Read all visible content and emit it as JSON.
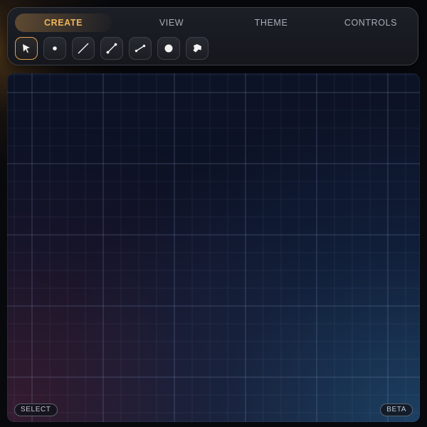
{
  "toolbar": {
    "tabs": [
      {
        "label": "CREATE",
        "active": true
      },
      {
        "label": "VIEW",
        "active": false
      },
      {
        "label": "THEME",
        "active": false
      },
      {
        "label": "CONTROLS",
        "active": false
      }
    ],
    "tools": [
      {
        "icon": "pointer-arrow-icon",
        "active": true
      },
      {
        "icon": "point-icon",
        "active": false
      },
      {
        "icon": "line-icon",
        "active": false
      },
      {
        "icon": "segment-icon",
        "active": false
      },
      {
        "icon": "short-segment-icon",
        "active": false
      },
      {
        "icon": "circle-icon",
        "active": false
      },
      {
        "icon": "polygon-icon",
        "active": false
      }
    ]
  },
  "canvas": {
    "mode_label": "SELECT",
    "badge_label": "BETA"
  },
  "colors": {
    "accent": "#f0b45a",
    "active_border": "#e0a14a",
    "tab_text": "#a9adb5",
    "canvas_bg": "#0d1326",
    "grid_line": "#8aa0c8"
  }
}
